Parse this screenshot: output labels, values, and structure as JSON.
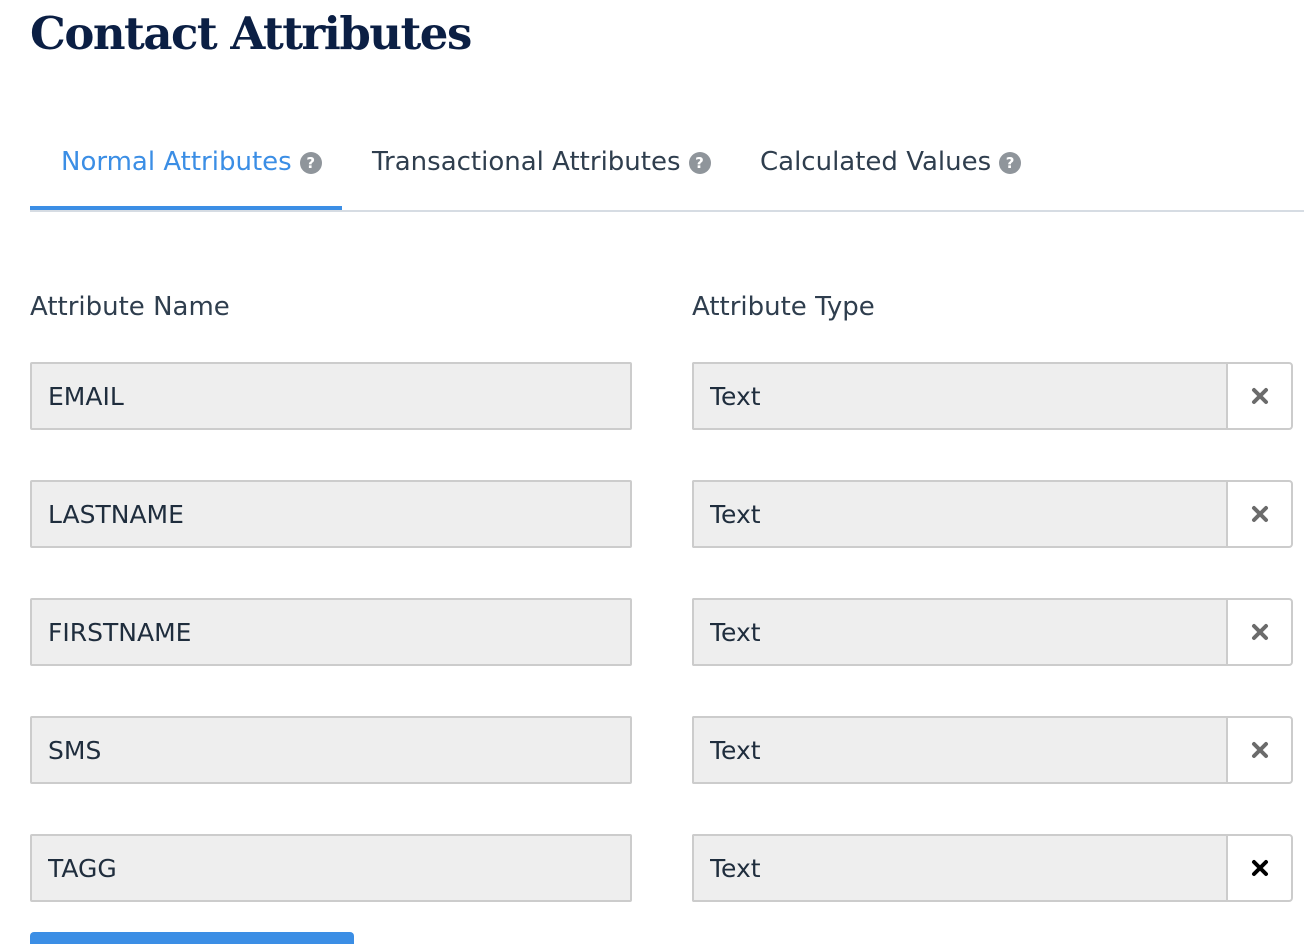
{
  "page": {
    "title": "Contact Attributes"
  },
  "tabs": [
    {
      "label": "Normal Attributes",
      "icon": "help-circle-icon",
      "active": true
    },
    {
      "label": "Transactional Attributes",
      "icon": "help-circle-icon",
      "active": false
    },
    {
      "label": "Calculated Values",
      "icon": "help-circle-icon",
      "active": false
    }
  ],
  "columns": {
    "name": "Attribute Name",
    "type": "Attribute Type"
  },
  "attributes": [
    {
      "name": "EMAIL",
      "type": "Text"
    },
    {
      "name": "LASTNAME",
      "type": "Text"
    },
    {
      "name": "FIRSTNAME",
      "type": "Text"
    },
    {
      "name": "SMS",
      "type": "Text"
    },
    {
      "name": "TAGG",
      "type": "Text"
    }
  ],
  "colors": {
    "accent": "#3b8ee5",
    "title": "#0b1f44",
    "input_bg": "#eeeeee",
    "border": "#cccccc",
    "delete_icon": "#6b6b6b",
    "delete_icon_hover": "#000000"
  }
}
